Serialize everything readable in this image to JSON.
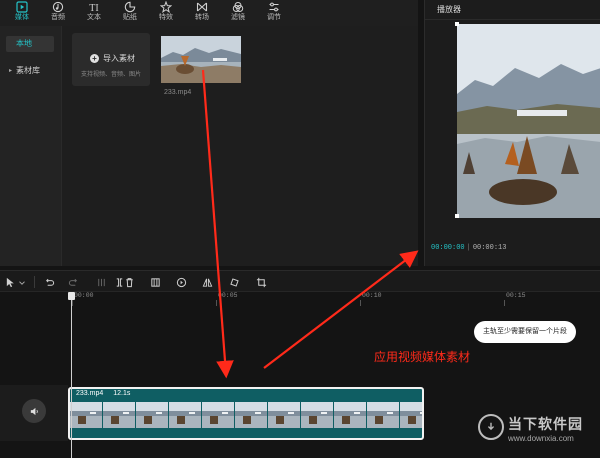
{
  "toolbar": {
    "items": [
      {
        "label": "媒体",
        "icon": "media-icon",
        "active": true
      },
      {
        "label": "音频",
        "icon": "audio-icon"
      },
      {
        "label": "文本",
        "icon": "text-icon"
      },
      {
        "label": "贴纸",
        "icon": "sticker-icon"
      },
      {
        "label": "特效",
        "icon": "effects-icon"
      },
      {
        "label": "转场",
        "icon": "transition-icon"
      },
      {
        "label": "滤镜",
        "icon": "filter-icon"
      },
      {
        "label": "调节",
        "icon": "adjust-icon"
      }
    ],
    "accent": "#25c3c7"
  },
  "sidebar": {
    "items": [
      {
        "label": "本地",
        "active": true
      },
      {
        "label": "素材库",
        "has_arrow": true
      }
    ]
  },
  "media": {
    "import_label": "导入素材",
    "import_hint": "支持视频、音频、图片",
    "files": [
      {
        "name": "233.mp4"
      }
    ]
  },
  "player": {
    "title": "播放器",
    "current_time": "00:00:00",
    "total_time": "00:00:13"
  },
  "timeline": {
    "ruler": [
      "00:00",
      "00:05",
      "00:10",
      "00:15"
    ],
    "clip": {
      "name": "233.mp4",
      "duration": "12.1s",
      "color": "#0f5e63"
    },
    "tooltip": "主轨至少需要保留一个片段"
  },
  "annotation": {
    "text": "应用视频媒体素材",
    "color": "#ff2a1a"
  },
  "watermark": {
    "title": "当下软件园",
    "url": "www.downxia.com"
  }
}
